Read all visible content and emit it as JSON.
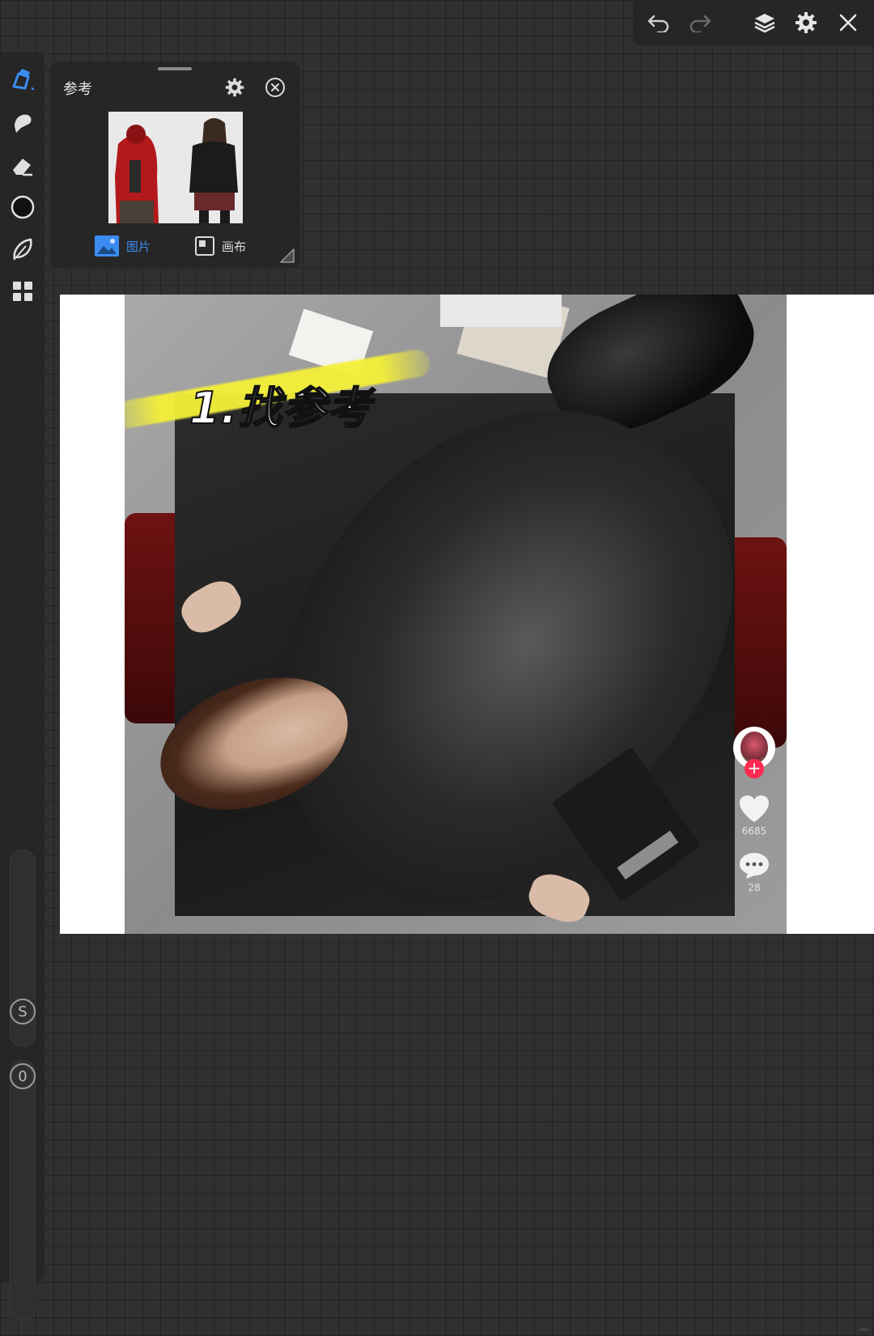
{
  "toolbar": {
    "undo_icon": "undo-icon",
    "redo_icon": "redo-icon",
    "layers_icon": "layers-icon",
    "settings_icon": "gear-icon",
    "close_icon": "close-icon"
  },
  "sidebar": {
    "tools": [
      "brush-icon",
      "smudge-icon",
      "eraser-icon",
      "color-icon",
      "lasso-icon",
      "more-icon"
    ],
    "size_badge": "S",
    "opacity_badge": "0"
  },
  "reference_panel": {
    "title": "参考",
    "tabs": [
      {
        "label": "图片",
        "active": true
      },
      {
        "label": "画布",
        "active": false
      }
    ],
    "accent_color": "#3b8cf0"
  },
  "canvas": {
    "caption": "1.找参考",
    "likes": "6685",
    "comments": "28"
  }
}
